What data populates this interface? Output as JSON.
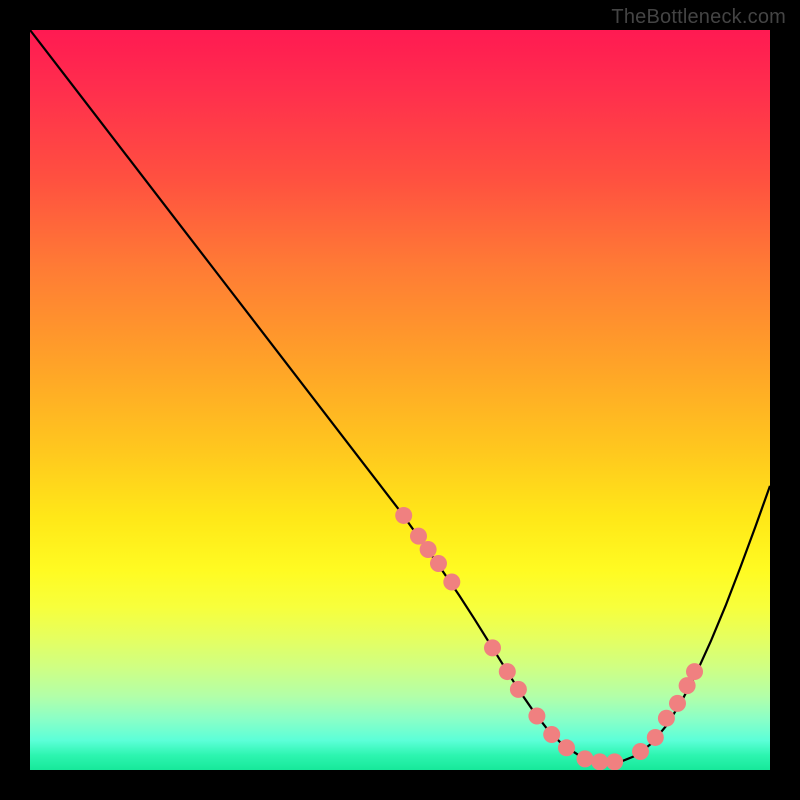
{
  "watermark": "TheBottleneck.com",
  "chart_data": {
    "type": "line",
    "title": "",
    "xlabel": "",
    "ylabel": "",
    "xlim": [
      0,
      100
    ],
    "ylim": [
      0,
      100
    ],
    "series": [
      {
        "name": "curve",
        "x": [
          0,
          5,
          10,
          15,
          20,
          25,
          30,
          35,
          40,
          45,
          50,
          55,
          58,
          60,
          62,
          64,
          66,
          68,
          70,
          72,
          74,
          76,
          78,
          80,
          82,
          84,
          86,
          88,
          90,
          92,
          94,
          96,
          98,
          100
        ],
        "y": [
          100,
          93.5,
          87,
          80.5,
          74,
          67.5,
          61,
          54.5,
          48,
          41.5,
          35,
          28,
          23.6,
          20.5,
          17.3,
          14.1,
          10.9,
          8.0,
          5.4,
          3.4,
          2.1,
          1.3,
          1.0,
          1.2,
          2.0,
          3.6,
          6.0,
          9.2,
          13.0,
          17.4,
          22.2,
          27.4,
          32.8,
          38.4
        ]
      },
      {
        "name": "markers",
        "x": [
          50.5,
          52.5,
          53.8,
          55.2,
          57.0,
          62.5,
          64.5,
          66.0,
          68.5,
          70.5,
          72.5,
          75.0,
          77.0,
          79.0,
          82.5,
          84.5,
          86.0,
          87.5,
          88.8,
          89.8
        ],
        "y": [
          34.4,
          31.6,
          29.8,
          27.9,
          25.4,
          16.5,
          13.3,
          10.9,
          7.3,
          4.8,
          3.0,
          1.5,
          1.1,
          1.1,
          2.5,
          4.4,
          7.0,
          9.0,
          11.4,
          13.3
        ]
      }
    ],
    "marker_color": "#f08080",
    "curve_color": "#000000"
  }
}
